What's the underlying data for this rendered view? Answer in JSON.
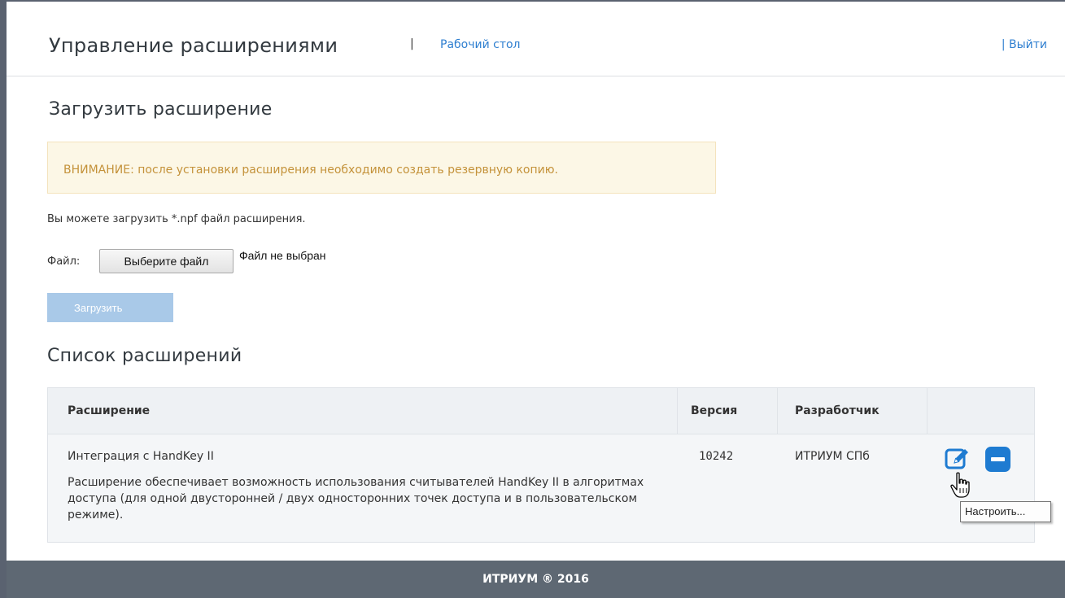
{
  "header": {
    "title": "Управление расширениями",
    "separator": "|",
    "nav_link": "Рабочий стол",
    "logout": "Выйти"
  },
  "upload_section": {
    "heading": "Загрузить расширение",
    "warning": "ВНИМАНИЕ: после установки расширения необходимо создать резервную копию.",
    "info": "Вы можете загрузить *.npf файл расширения.",
    "file_label": "Файл:",
    "choose_file_button": "Выберите файл",
    "file_status": "Файл не выбран",
    "upload_button": "Загрузить"
  },
  "list_section": {
    "heading": "Список расширений",
    "columns": [
      "Расширение",
      "Версия",
      "Разработчик"
    ],
    "rows": [
      {
        "name": "Интеграция с HandKey II",
        "description": "Расширение обеспечивает возможность использования считывателей HandKey II в алгоритмах доступа (для одной двусторонней / двух односторонних точек доступа и в пользовательском режиме).",
        "version": "10242",
        "developer": "ИТРИУМ СПб",
        "actions": [
          "edit-icon",
          "remove-icon"
        ]
      }
    ]
  },
  "tooltip": "Настроить...",
  "footer": {
    "text": "ИТРИУМ ® 2016"
  },
  "colors": {
    "link": "#2f7fd0",
    "warning_bg": "#fcf7e6",
    "warning_text": "#c4923a",
    "upload_button_disabled": "#a9c9e8",
    "action_blue": "#1e7bd1",
    "footer_bg": "#5e6873"
  }
}
